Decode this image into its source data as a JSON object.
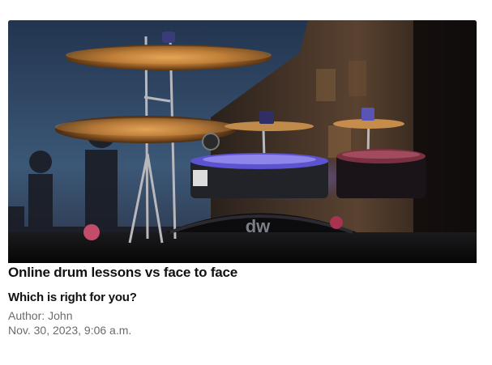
{
  "article": {
    "image_alt": "Drum kit with cymbals at dusk, dw bass drum",
    "drum_brand": "dw",
    "title": "Online drum lessons vs face to face",
    "subtitle": "Which is right for you?",
    "author_label": "Author:",
    "author_name": "John",
    "date": "Nov. 30, 2023, 9:06 a.m."
  },
  "colors": {
    "sky_top": "#1d2c44",
    "sky_bottom": "#3a5474",
    "cymbal": "#b27a3c",
    "drum_glow": "#6a5cff",
    "text": "#111111",
    "meta_text": "#6b6b6b"
  }
}
